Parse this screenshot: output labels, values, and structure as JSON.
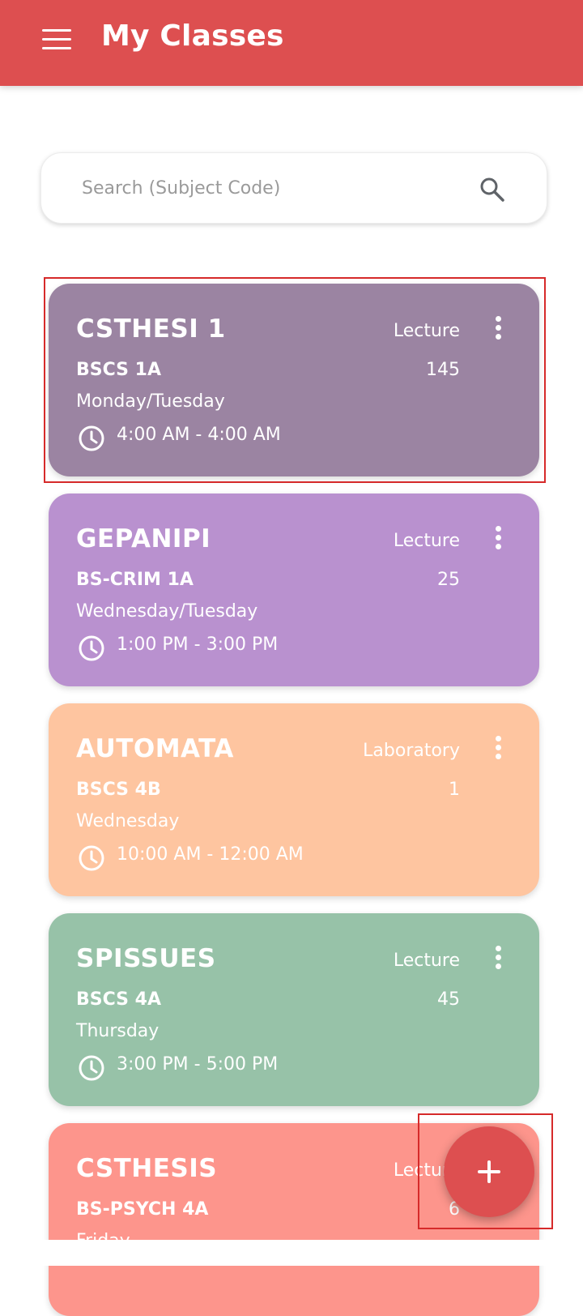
{
  "appbar": {
    "title": "My Classes",
    "menu_icon": "hamburger-menu-icon"
  },
  "search": {
    "placeholder": "Search (Subject Code)",
    "icon": "search-icon"
  },
  "colors": {
    "appbar": "#dd4f50",
    "fab": "#dd4f50",
    "highlight": "#d62a2a"
  },
  "classes": [
    {
      "code": "CSTHESI 1",
      "type": "Lecture",
      "section": "BSCS 1A",
      "count": "145",
      "days": "Monday/Tuesday",
      "time": "4:00 AM - 4:00 AM",
      "color": "#9b84a2"
    },
    {
      "code": "GEPANIPI",
      "type": "Lecture",
      "section": "BS-CRIM 1A",
      "count": "25",
      "days": "Wednesday/Tuesday",
      "time": "1:00 PM - 3:00 PM",
      "color": "#b991cf"
    },
    {
      "code": "AUTOMATA",
      "type": "Laboratory",
      "section": "BSCS 4B",
      "count": "1",
      "days": "Wednesday",
      "time": "10:00 AM - 12:00 AM",
      "color": "#fec5a0"
    },
    {
      "code": "SPISSUES",
      "type": "Lecture",
      "section": "BSCS 4A",
      "count": "45",
      "days": "Thursday",
      "time": "3:00 PM - 5:00 PM",
      "color": "#97c2a8"
    },
    {
      "code": "CSTHESIS",
      "type": "Lecture",
      "section": "BS-PSYCH 4A",
      "count": "6",
      "days": "Friday",
      "time": "",
      "color": "#fd958c"
    }
  ],
  "fab": {
    "icon": "plus-icon"
  }
}
